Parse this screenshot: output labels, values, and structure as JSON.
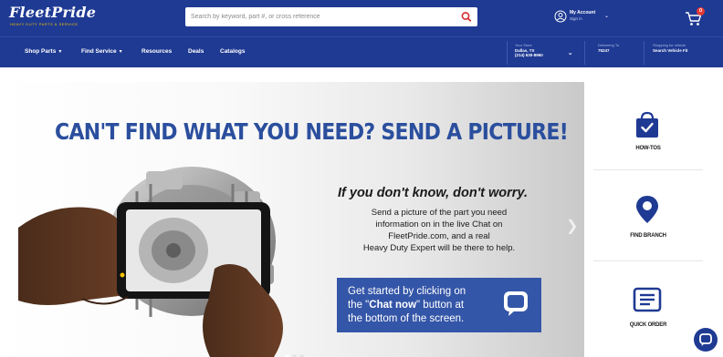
{
  "header": {
    "logo_text": "FleetPride",
    "logo_tagline": "HEAVY DUTY PARTS & SERVICE",
    "search_placeholder": "Search by keyword, part #, or cross reference",
    "account_title": "My Account",
    "account_sub": "Sign in",
    "cart_count": "0"
  },
  "nav": {
    "items": [
      {
        "label": "Shop Parts",
        "has_dropdown": true
      },
      {
        "label": "Find Service",
        "has_dropdown": true
      },
      {
        "label": "Resources",
        "has_dropdown": false
      },
      {
        "label": "Deals",
        "has_dropdown": false
      },
      {
        "label": "Catalogs",
        "has_dropdown": false
      }
    ],
    "store": {
      "small": "Your Store",
      "line1": "Dallas, TX",
      "line2": "(214) 630-8960"
    },
    "delivering": {
      "small": "Delivering To",
      "line1": "75247"
    },
    "vehicle": {
      "small": "Shopping for vehicle",
      "line1": "Search Vehicle Fit"
    }
  },
  "banner": {
    "headline": "CAN'T FIND WHAT YOU NEED? SEND A PICTURE!",
    "subhead": "If you don't know, don't worry.",
    "body_lines": [
      "Send a picture of the part you need",
      "information on in the live Chat on",
      "FleetPride.com, and a real",
      "Heavy Duty Expert will be there to help."
    ],
    "cta_line1": "Get started by clicking on",
    "cta_line2_pre": "the \"",
    "cta_line2_bold": "Chat now",
    "cta_line2_post": "\" button at",
    "cta_line3": "the bottom of the screen.",
    "slide_count": 3,
    "active_slide": 1
  },
  "quick_links": [
    {
      "label": "HOW-TOS",
      "icon": "shopping-bag-check-icon"
    },
    {
      "label": "FIND BRANCH",
      "icon": "map-pin-icon"
    },
    {
      "label": "QUICK ORDER",
      "icon": "order-list-icon"
    }
  ],
  "colors": {
    "brand_blue": "#1f3a93",
    "headline_blue": "#2b4f9e",
    "cta_blue": "#3456a8",
    "logo_yellow": "#f2c200",
    "search_red": "#d32f2f"
  }
}
